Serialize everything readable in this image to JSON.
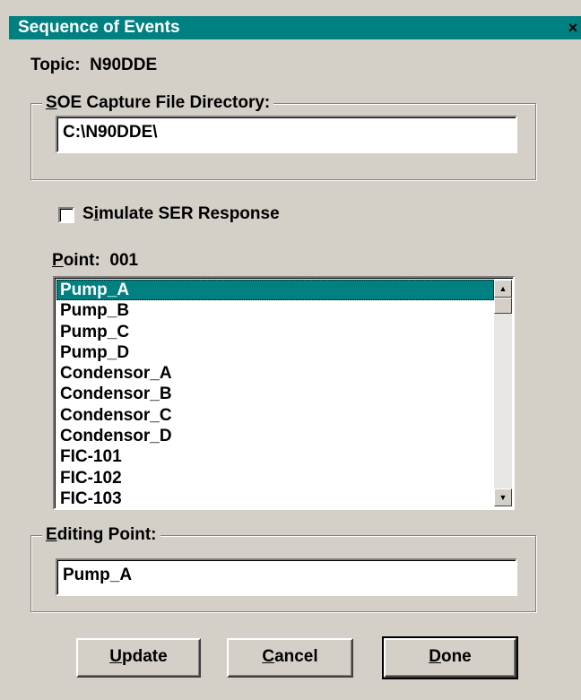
{
  "window": {
    "title": "Sequence of Events",
    "close_glyph": "×"
  },
  "topic": {
    "label": "Topic:",
    "value": "N90DDE"
  },
  "soe_group": {
    "mnemonic": "S",
    "label_rest": "OE Capture File Directory:",
    "value": "C:\\N90DDE\\"
  },
  "simulate": {
    "label_pre": "S",
    "mnemonic": "i",
    "label_post": "mulate SER Response",
    "checked": false
  },
  "point": {
    "mnemonic": "P",
    "label_rest": "oint:",
    "value": "001"
  },
  "point_list": {
    "items": [
      "Pump_A",
      "Pump_B",
      "Pump_C",
      "Pump_D",
      "Condensor_A",
      "Condensor_B",
      "Condensor_C",
      "Condensor_D",
      "FIC-101",
      "FIC-102",
      "FIC-103"
    ],
    "selected_index": 0,
    "scroll_up_glyph": "▲",
    "scroll_down_glyph": "▼"
  },
  "editing_group": {
    "mnemonic": "E",
    "label_rest": "diting Point:",
    "value": "Pump_A"
  },
  "buttons": {
    "update": {
      "mnemonic": "U",
      "rest": "pdate"
    },
    "cancel": {
      "mnemonic": "C",
      "rest": "ancel"
    },
    "done": {
      "mnemonic": "D",
      "rest": "one"
    }
  }
}
